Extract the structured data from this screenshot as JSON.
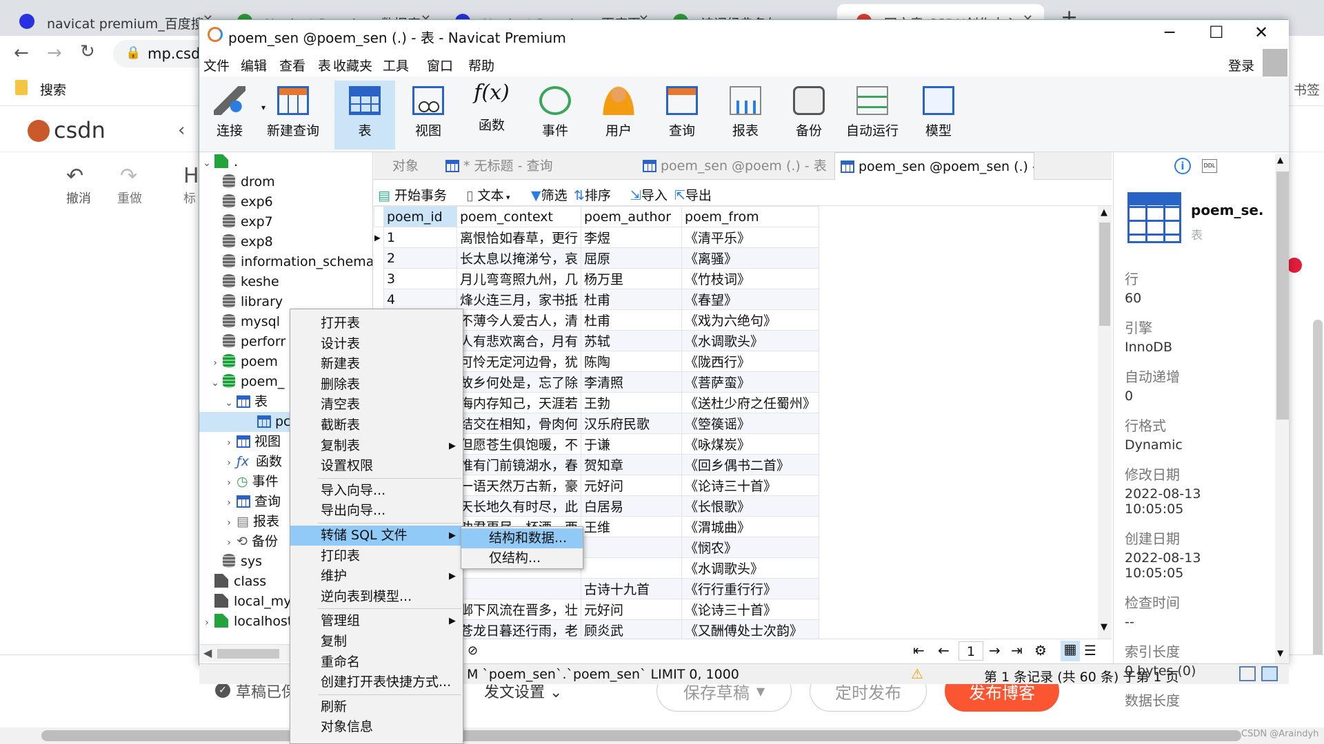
{
  "browser": {
    "tabs": [
      {
        "label": "navicat premium_百度搜",
        "icon": "baidu-paw-icon",
        "color": "#2932e1"
      },
      {
        "label": "Navicat Premium 数据库",
        "icon": "green-leaf-icon",
        "color": "#2e9e3a"
      },
      {
        "label": "Navicat Premium_百度百",
        "icon": "baidu-paw-icon",
        "color": "#2932e1"
      },
      {
        "label": "诗词经典名句",
        "icon": "green-leaf-icon",
        "color": "#2e9e3a"
      },
      {
        "label": "写文章-CSDN创作中心",
        "icon": "csdn-icon",
        "color": "#e33e33"
      }
    ],
    "close_glyph": "✕",
    "new_tab_glyph": "+",
    "address": "mp.csd",
    "bookmark_search": "搜索",
    "bookmarks_right": "书签"
  },
  "csdn": {
    "logo": "csdn",
    "undo": "撤消",
    "redo": "重做",
    "heading_partial": "H",
    "heading_partial_label": "标",
    "draft_saved": "草稿已保",
    "publish_settings": "发文设置",
    "save_draft": "保存草稿",
    "schedule": "定时发布",
    "publish": "发布博客",
    "watermark": "CSDN @Araindyh",
    "brand_color": "#fc5531"
  },
  "window": {
    "title": "poem_sen @poem_sen (.) - 表 - Navicat Premium",
    "login": "登录"
  },
  "menus": [
    "文件",
    "编辑",
    "查看",
    "表",
    "收藏夹",
    "工具",
    "窗口",
    "帮助"
  ],
  "toolbar": [
    {
      "label": "连接",
      "icon": "connection-plug-icon"
    },
    {
      "label": "新建查询",
      "icon": "new-query-icon"
    },
    {
      "label": "表",
      "icon": "table-icon",
      "selected": true
    },
    {
      "label": "视图",
      "icon": "view-icon"
    },
    {
      "label": "函数",
      "icon": "function-icon"
    },
    {
      "label": "事件",
      "icon": "clock-icon"
    },
    {
      "label": "用户",
      "icon": "user-icon"
    },
    {
      "label": "查询",
      "icon": "query-icon"
    },
    {
      "label": "报表",
      "icon": "report-icon"
    },
    {
      "label": "备份",
      "icon": "backup-icon"
    },
    {
      "label": "自动运行",
      "icon": "auto-run-icon"
    },
    {
      "label": "模型",
      "icon": "model-icon"
    }
  ],
  "tree": [
    {
      "label": ".",
      "type": "conn-g",
      "level": 0,
      "arrow": "v"
    },
    {
      "label": "drom",
      "type": "db",
      "level": 1
    },
    {
      "label": "exp6",
      "type": "db",
      "level": 1
    },
    {
      "label": "exp7",
      "type": "db",
      "level": 1
    },
    {
      "label": "exp8",
      "type": "db",
      "level": 1
    },
    {
      "label": "information_schema",
      "type": "db",
      "level": 1
    },
    {
      "label": "keshe",
      "type": "db",
      "level": 1
    },
    {
      "label": "library",
      "type": "db",
      "level": 1
    },
    {
      "label": "mysql",
      "type": "db",
      "level": 1
    },
    {
      "label": "perforr",
      "type": "db",
      "level": 1
    },
    {
      "label": "poem",
      "type": "db-g",
      "level": 1,
      "arrow": ">"
    },
    {
      "label": "poem_",
      "type": "db-g",
      "level": 1,
      "arrow": "v"
    },
    {
      "label": "表",
      "type": "tbl",
      "level": 2,
      "arrow": "v"
    },
    {
      "label": "pc",
      "type": "tbl",
      "level": 3,
      "selected": true
    },
    {
      "label": "视图",
      "type": "tbl",
      "level": 2,
      "arrow": ">"
    },
    {
      "label": "函数",
      "type": "fx",
      "level": 2,
      "arrow": ">"
    },
    {
      "label": "事件",
      "type": "clk",
      "level": 2,
      "arrow": ">"
    },
    {
      "label": "查询",
      "type": "tbl",
      "level": 2,
      "arrow": ">"
    },
    {
      "label": "报表",
      "type": "rpt",
      "level": 2,
      "arrow": ">"
    },
    {
      "label": "备份",
      "type": "bak",
      "level": 2,
      "arrow": ">"
    },
    {
      "label": "sys",
      "type": "db",
      "level": 1
    },
    {
      "label": "class",
      "type": "conn",
      "level": 0
    },
    {
      "label": "local_mys",
      "type": "conn",
      "level": 0
    },
    {
      "label": "localhost",
      "type": "conn-g",
      "level": 0,
      "arrow": ">"
    }
  ],
  "content_tabs": {
    "objects": "对象",
    "untitled_query": "* 无标题 - 查询",
    "poem_table": "poem_sen @poem (.) - 表",
    "poem_sen_table": "poem_sen @poem_sen (.) - ..."
  },
  "subtoolbar": {
    "begin_tx": "开始事务",
    "text": "文本",
    "filter": "筛选",
    "sort": "排序",
    "import": "导入",
    "export": "导出"
  },
  "grid": {
    "columns": [
      "poem_id",
      "poem_context",
      "poem_author",
      "poem_from"
    ],
    "rows": [
      [
        "1",
        "离恨恰如春草，更行",
        "李煜",
        "《清平乐》"
      ],
      [
        "2",
        "长太息以掩涕兮，哀",
        "屈原",
        "《离骚》"
      ],
      [
        "3",
        "月儿弯弯照九州，几",
        "杨万里",
        "《竹枝词》"
      ],
      [
        "4",
        "烽火连三月，家书抵",
        "杜甫",
        "《春望》"
      ],
      [
        "5",
        "不薄今人爱古人，清",
        "杜甫",
        "《戏为六绝句》"
      ],
      [
        "",
        "人有悲欢离合，月有",
        "苏轼",
        "《水调歌头》"
      ],
      [
        "",
        "可怜无定河边骨，犹",
        "陈陶",
        "《陇西行》"
      ],
      [
        "",
        "故乡何处是，忘了除",
        "李清照",
        "《菩萨蛮》"
      ],
      [
        "",
        "海内存知己，天涯若",
        "王勃",
        "《送杜少府之任蜀州》"
      ],
      [
        "",
        "结交在相知，骨肉何",
        "汉乐府民歌",
        "《箜篌谣》"
      ],
      [
        "",
        "但愿苍生俱饱暖，不",
        "于谦",
        "《咏煤炭》"
      ],
      [
        "",
        "惟有门前镜湖水，春",
        "贺知章",
        "《回乡偶书二首》"
      ],
      [
        "",
        "一语天然万古新，豪",
        "元好问",
        "《论诗三十首》"
      ],
      [
        "",
        "天长地久有时尽，此",
        "白居易",
        "《长恨歌》"
      ],
      [
        "",
        "劝君更尽一杯酒，西",
        "王维",
        "《渭城曲》"
      ],
      [
        "",
        "",
        "",
        "《悯农》"
      ],
      [
        "",
        "",
        "",
        "《水调歌头》"
      ],
      [
        "",
        "",
        "古诗十九首",
        "《行行重行行》"
      ],
      [
        "",
        "邺下风流在晋多，壮",
        "元好问",
        "《论诗三十首》"
      ],
      [
        "",
        "苍龙日暮还行雨，老",
        "顾炎武",
        "《又酬傅处士次韵》"
      ]
    ]
  },
  "grid_nav": {
    "page": "1",
    "sql_fragment": "M `poem_sen`.`poem_sen` LIMIT 0, 1000",
    "record_info": "第 1 条记录 (共 60 条) 于第 1 页"
  },
  "info": {
    "name": "poem_se.",
    "type": "表",
    "fields": [
      {
        "label": "行",
        "value": "60"
      },
      {
        "label": "引擎",
        "value": "InnoDB"
      },
      {
        "label": "自动递增",
        "value": "0"
      },
      {
        "label": "行格式",
        "value": "Dynamic"
      },
      {
        "label": "修改日期",
        "value": "2022-08-13 10:05:05"
      },
      {
        "label": "创建日期",
        "value": "2022-08-13 10:05:05"
      },
      {
        "label": "检查时间",
        "value": "--"
      },
      {
        "label": "索引长度",
        "value": "0 bytes (0)"
      },
      {
        "label": "数据长度",
        "value": ""
      }
    ]
  },
  "context_menu": {
    "items": [
      {
        "label": "打开表"
      },
      {
        "label": "设计表"
      },
      {
        "label": "新建表"
      },
      {
        "label": "删除表"
      },
      {
        "label": "清空表"
      },
      {
        "label": "截断表"
      },
      {
        "label": "复制表",
        "sub": true
      },
      {
        "label": "设置权限"
      },
      {
        "sep": true
      },
      {
        "label": "导入向导..."
      },
      {
        "label": "导出向导..."
      },
      {
        "sep": true
      },
      {
        "label": "转储 SQL 文件",
        "sub": true,
        "highlight": true
      },
      {
        "label": "打印表"
      },
      {
        "label": "维护",
        "sub": true
      },
      {
        "label": "逆向表到模型..."
      },
      {
        "sep": true
      },
      {
        "label": "管理组",
        "sub": true
      },
      {
        "label": "复制"
      },
      {
        "label": "重命名"
      },
      {
        "label": "创建打开表快捷方式..."
      },
      {
        "sep": true
      },
      {
        "label": "刷新"
      },
      {
        "label": "对象信息"
      }
    ],
    "submenu": [
      {
        "label": "结构和数据...",
        "highlight": true
      },
      {
        "label": "仅结构..."
      }
    ]
  }
}
